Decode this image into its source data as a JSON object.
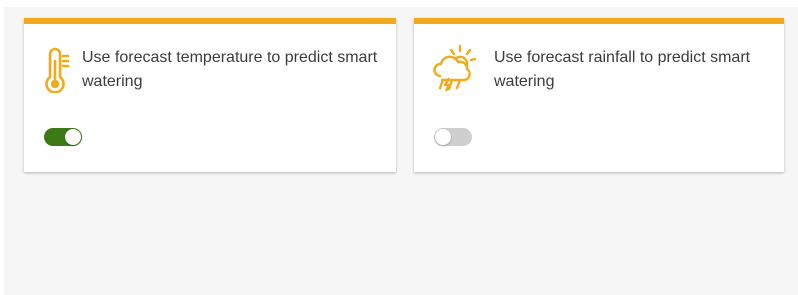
{
  "settings": [
    {
      "icon": "thermometer-icon",
      "label": "Use forecast temperature to predict smart watering",
      "enabled": true
    },
    {
      "icon": "weather-storm-icon",
      "label": "Use forecast rainfall to predict smart watering",
      "enabled": false
    }
  ],
  "colors": {
    "accent": "#f2a91b",
    "toggle_on": "#3c7a16",
    "toggle_off": "#cfcfcf",
    "background": "#f6f6f6"
  }
}
